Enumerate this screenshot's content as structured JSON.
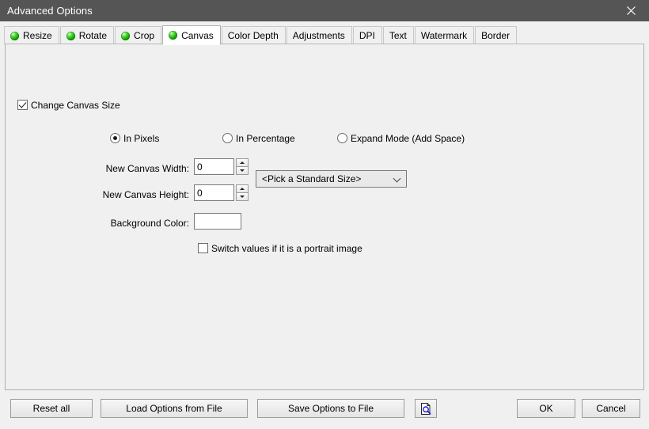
{
  "window": {
    "title": "Advanced Options",
    "close_icon": "close-icon",
    "close_glyph": "✕"
  },
  "tabs": [
    {
      "label": "Resize",
      "has_led": true,
      "selected": false
    },
    {
      "label": "Rotate",
      "has_led": true,
      "selected": false
    },
    {
      "label": "Crop",
      "has_led": true,
      "selected": false
    },
    {
      "label": "Canvas",
      "has_led": true,
      "selected": true
    },
    {
      "label": "Color Depth",
      "has_led": false,
      "selected": false
    },
    {
      "label": "Adjustments",
      "has_led": false,
      "selected": false
    },
    {
      "label": "DPI",
      "has_led": false,
      "selected": false
    },
    {
      "label": "Text",
      "has_led": false,
      "selected": false
    },
    {
      "label": "Watermark",
      "has_led": false,
      "selected": false
    },
    {
      "label": "Border",
      "has_led": false,
      "selected": false
    }
  ],
  "canvas_panel": {
    "change_canvas_size": {
      "label": "Change Canvas Size",
      "checked": true
    },
    "mode_options": [
      {
        "label": "In Pixels",
        "selected": true
      },
      {
        "label": "In Percentage",
        "selected": false
      },
      {
        "label": "Expand Mode (Add Space)",
        "selected": false
      }
    ],
    "new_canvas_width": {
      "label": "New Canvas Width:",
      "value": "0"
    },
    "new_canvas_height": {
      "label": "New Canvas Height:",
      "value": "0"
    },
    "background_color": {
      "label": "Background Color:",
      "value": "#ffffff"
    },
    "standard_size": {
      "selected_option": "<Pick a Standard Size>",
      "chevron_icon": "chevron-down-icon"
    },
    "switch_values": {
      "label": "Switch values if it is a portrait image",
      "checked": false
    }
  },
  "footer": {
    "reset_all": "Reset all",
    "load_options": "Load Options from File",
    "save_options": "Save Options to File",
    "preview_icon": "document-magnifier-icon",
    "ok": "OK",
    "cancel": "Cancel"
  },
  "colors": {
    "titlebar_bg": "#555555",
    "window_bg": "#f0f0f0",
    "led_green": "#17b400",
    "selected_tab_bg": "#ffffff",
    "field_border": "#7a7a7a"
  }
}
